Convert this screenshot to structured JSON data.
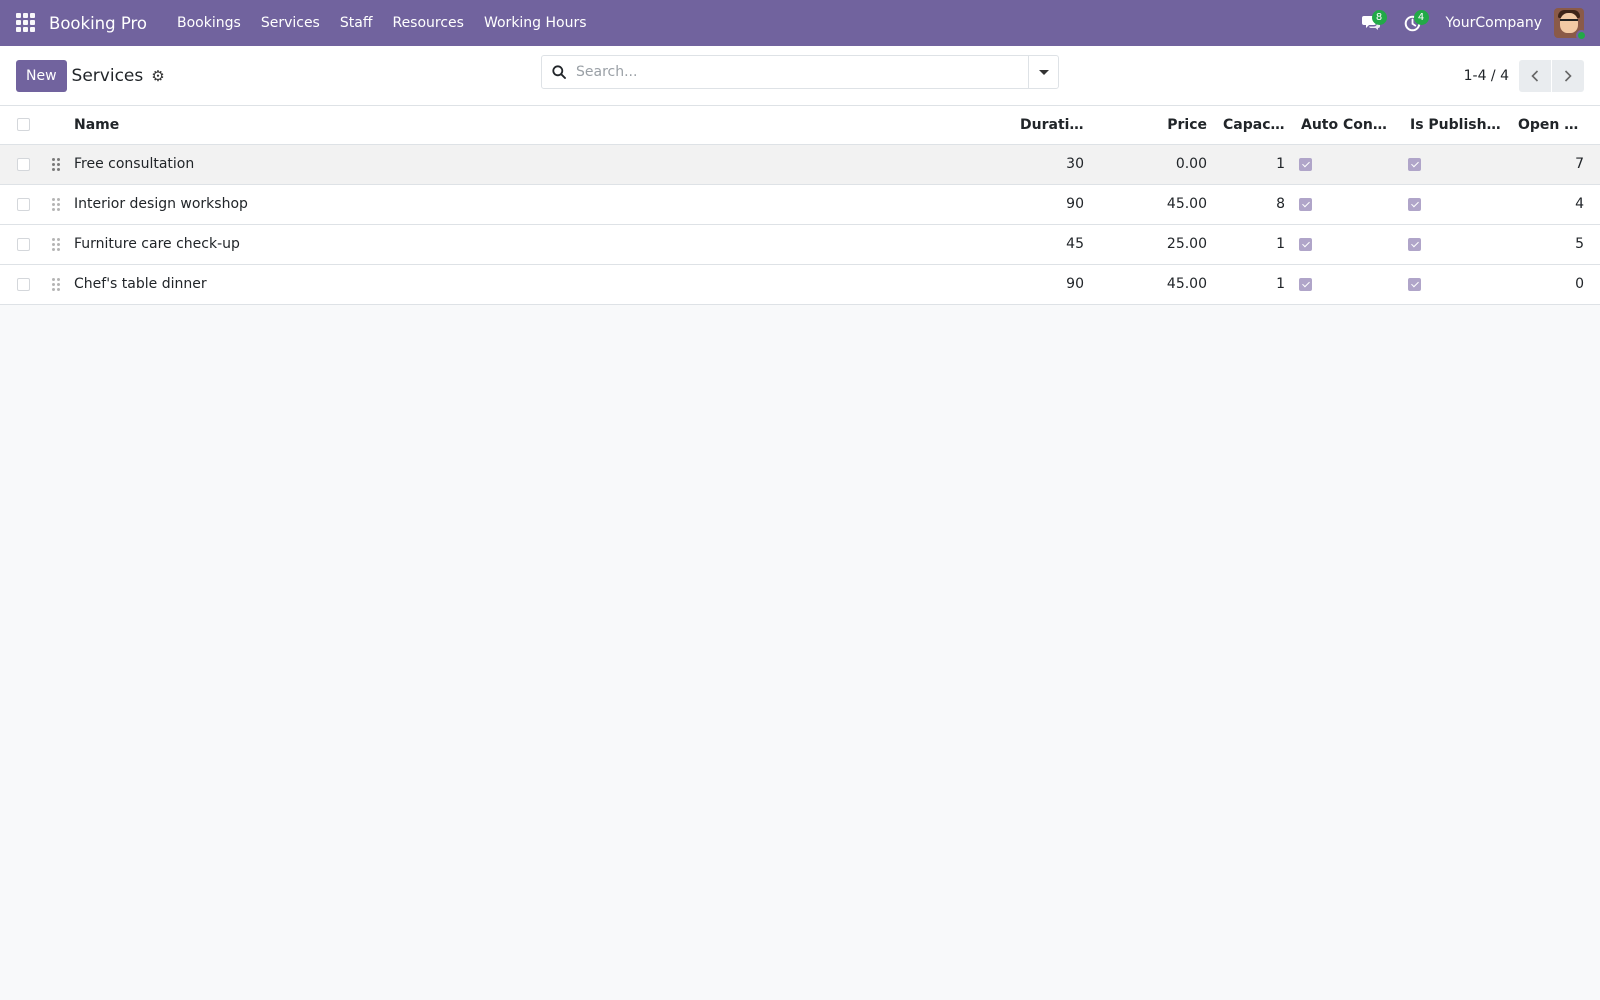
{
  "app": {
    "brand": "Booking Pro"
  },
  "nav": {
    "items": [
      "Bookings",
      "Services",
      "Staff",
      "Resources",
      "Working Hours"
    ]
  },
  "systray": {
    "messages_count": "8",
    "activities_count": "4",
    "company": "YourCompany"
  },
  "control": {
    "new_label": "New",
    "title": "Services"
  },
  "search": {
    "placeholder": "Search..."
  },
  "pager": {
    "value": "1-4 / 4"
  },
  "table": {
    "headers": {
      "name": "Name",
      "duration": "Duratio...",
      "price": "Price",
      "capacity": "Capacity",
      "auto_confirm": "Auto Confirm",
      "is_published": "Is Published",
      "open_bookings": "Open bo..."
    },
    "rows": [
      {
        "name": "Free consultation",
        "duration": "30",
        "price": "0.00",
        "capacity": "1",
        "auto_confirm": true,
        "is_published": true,
        "open_bookings": "7"
      },
      {
        "name": "Interior design workshop",
        "duration": "90",
        "price": "45.00",
        "capacity": "8",
        "auto_confirm": true,
        "is_published": true,
        "open_bookings": "4"
      },
      {
        "name": "Furniture care check-up",
        "duration": "45",
        "price": "25.00",
        "capacity": "1",
        "auto_confirm": true,
        "is_published": true,
        "open_bookings": "5"
      },
      {
        "name": "Chef's table dinner",
        "duration": "90",
        "price": "45.00",
        "capacity": "1",
        "auto_confirm": true,
        "is_published": true,
        "open_bookings": "0"
      }
    ]
  },
  "colors": {
    "brand": "#71639e",
    "badge": "#22a947",
    "checkbox_checked": "#b0a5c9"
  }
}
